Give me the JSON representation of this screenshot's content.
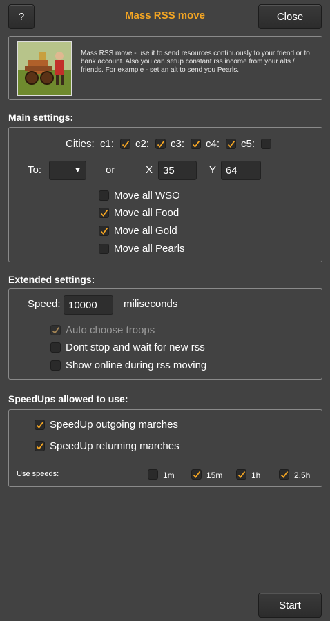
{
  "header": {
    "help_label": "?",
    "title": "Mass RSS move",
    "close_label": "Close"
  },
  "intro": {
    "description": "Mass RSS move - use it to send resources continuously to your friend or to bank account. Also you can setup constant rss income from your alts / friends. For example - set an alt to send you Pearls."
  },
  "main_settings": {
    "title": "Main settings:",
    "cities_label": "Cities:",
    "cities": [
      {
        "label": "c1:",
        "checked": true
      },
      {
        "label": "c2:",
        "checked": true
      },
      {
        "label": "c3:",
        "checked": true
      },
      {
        "label": "c4:",
        "checked": true
      },
      {
        "label": "c5:",
        "checked": false
      }
    ],
    "to_label": "To:",
    "to_value": "",
    "or_label": "or",
    "x_label": "X",
    "x_value": "35",
    "y_label": "Y",
    "y_value": "64",
    "options": [
      {
        "label": "Move all WSO",
        "checked": false
      },
      {
        "label": "Move all Food",
        "checked": true
      },
      {
        "label": "Move all Gold",
        "checked": true
      },
      {
        "label": "Move all Pearls",
        "checked": false
      }
    ]
  },
  "extended_settings": {
    "title": "Extended settings:",
    "speed_label": "Speed:",
    "speed_value": "10000",
    "speed_unit": "miliseconds",
    "options": [
      {
        "label": "Auto choose troops",
        "checked": true,
        "disabled": true
      },
      {
        "label": "Dont stop and wait for new rss",
        "checked": false,
        "disabled": false
      },
      {
        "label": "Show online during rss moving",
        "checked": false,
        "disabled": false
      }
    ]
  },
  "speedups": {
    "title": "SpeedUps allowed to use:",
    "options": [
      {
        "label": "SpeedUp outgoing marches",
        "checked": true
      },
      {
        "label": "SpeedUp returning marches",
        "checked": true
      }
    ],
    "use_speeds_label": "Use speeds:",
    "speeds": [
      {
        "label": "1m",
        "checked": false
      },
      {
        "label": "15m",
        "checked": true
      },
      {
        "label": "1h",
        "checked": true
      },
      {
        "label": "2.5h",
        "checked": true
      }
    ]
  },
  "footer": {
    "start_label": "Start"
  },
  "colors": {
    "background": "#424242",
    "title": "#f5a623",
    "check": "#f5a623",
    "border": "#8a8a8a"
  }
}
